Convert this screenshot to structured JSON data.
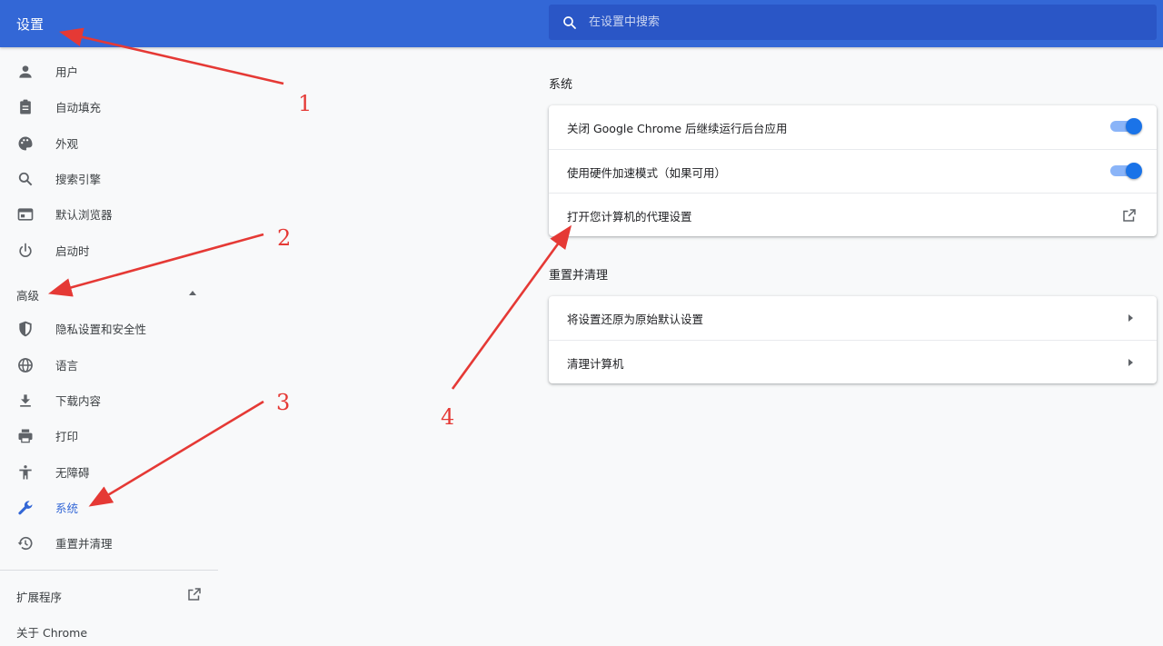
{
  "header": {
    "title": "设置",
    "search": {
      "placeholder": "在设置中搜索"
    }
  },
  "sidebar": {
    "items": [
      {
        "label": "用户",
        "icon": "person-icon"
      },
      {
        "label": "自动填充",
        "icon": "clipboard-icon"
      },
      {
        "label": "外观",
        "icon": "palette-icon"
      },
      {
        "label": "搜索引擎",
        "icon": "search-icon"
      },
      {
        "label": "默认浏览器",
        "icon": "browser-icon"
      },
      {
        "label": "启动时",
        "icon": "power-icon"
      }
    ],
    "advanced_label": "高级",
    "advanced_items": [
      {
        "label": "隐私设置和安全性",
        "icon": "shield-icon"
      },
      {
        "label": "语言",
        "icon": "globe-icon"
      },
      {
        "label": "下载内容",
        "icon": "download-icon"
      },
      {
        "label": "打印",
        "icon": "printer-icon"
      },
      {
        "label": "无障碍",
        "icon": "accessibility-icon"
      },
      {
        "label": "系统",
        "icon": "wrench-icon",
        "active": true
      },
      {
        "label": "重置并清理",
        "icon": "history-icon"
      }
    ],
    "extensions_label": "扩展程序",
    "about_label": "关于 Chrome"
  },
  "main": {
    "system": {
      "title": "系统",
      "rows": [
        {
          "label": "关闭 Google Chrome 后继续运行后台应用",
          "control": "toggle",
          "on": true
        },
        {
          "label": "使用硬件加速模式（如果可用）",
          "control": "toggle",
          "on": true
        },
        {
          "label": "打开您计算机的代理设置",
          "control": "external-link-icon"
        }
      ]
    },
    "reset": {
      "title": "重置并清理",
      "rows": [
        {
          "label": "将设置还原为原始默认设置",
          "control": "chevron-right-icon"
        },
        {
          "label": "清理计算机",
          "control": "chevron-right-icon"
        }
      ]
    }
  },
  "annotations": [
    "1",
    "2",
    "3",
    "4"
  ],
  "colors": {
    "header": "#3367d6",
    "search_bg": "#2a56c6",
    "accent": "#1a73e8",
    "annotation": "#e53935"
  }
}
